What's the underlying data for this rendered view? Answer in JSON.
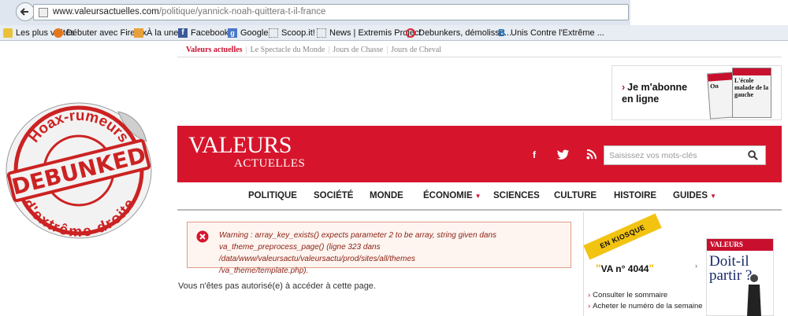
{
  "browser": {
    "url_host": "www.valeursactuelles.com",
    "url_path": "/politique/yannick-noah-quittera-t-il-france",
    "bookmarks": [
      {
        "label": "Les plus visités",
        "icon": "star-icon"
      },
      {
        "label": "Débuter avec Firefox",
        "icon": "firefox-icon"
      },
      {
        "label": "À la une",
        "icon": "feed-icon"
      },
      {
        "label": "Facebook",
        "icon": "facebook-icon"
      },
      {
        "label": "Google",
        "icon": "google-icon"
      },
      {
        "label": "Scoop.it!",
        "icon": "page-icon"
      },
      {
        "label": "News | Extremis Project",
        "icon": "page-icon"
      },
      {
        "label": "Debunkers, démolisse...",
        "icon": "target-icon"
      },
      {
        "label": "Unis Contre l'Extrême ...",
        "icon": "blogger-b-icon"
      }
    ]
  },
  "site_links": {
    "active": "Valeurs actuelles",
    "others": [
      "Le Spectacle du Monde",
      "Jours de Chasse",
      "Jours de Cheval"
    ]
  },
  "subscribe": {
    "label_line1": "Je m'abonne",
    "label_line2": "en ligne",
    "mag1_title": "On",
    "mag2_title": "L'école malade de la gauche"
  },
  "sticker": {
    "top_text": "Hoax-rumeurs",
    "center_text": "DEBUNKED",
    "bottom_text": "d'extrême-droite"
  },
  "header": {
    "logo_top": "VALEURS",
    "logo_bottom": "ACTUELLES",
    "search_placeholder": "Saisissez vos mots-clés"
  },
  "nav": {
    "items": [
      {
        "label": "POLITIQUE",
        "has_dropdown": false
      },
      {
        "label": "SOCIÉTÉ",
        "has_dropdown": false
      },
      {
        "label": "MONDE",
        "has_dropdown": false
      },
      {
        "label": "ÉCONOMIE",
        "has_dropdown": true
      },
      {
        "label": "SCIENCES",
        "has_dropdown": false
      },
      {
        "label": "CULTURE",
        "has_dropdown": false
      },
      {
        "label": "HISTOIRE",
        "has_dropdown": false
      },
      {
        "label": "GUIDES",
        "has_dropdown": true
      }
    ],
    "caret": "▼"
  },
  "warning": {
    "label": "Warning",
    "message_line1": " : array_key_exists() expects parameter 2 to be array, string given dans",
    "message_line2": "va_theme_preprocess_page() (ligne 323 dans /data/www/valeursactu/valeursactu/prod/sites/all/themes",
    "message_line3": "/va_theme/template.php)."
  },
  "access_message": "Vous n'êtes pas autorisé(e) à accéder à cette page.",
  "kiosk": {
    "badge": "EN KIOSQUE",
    "issue": "VA n° 4044",
    "links": [
      "Consulter le sommaire",
      "Acheter le numéro de la semaine"
    ],
    "cover_brand": "VALEURS",
    "cover_title_line1": "Doit-il",
    "cover_title_line2": "partir ?"
  },
  "colors": {
    "brand_red": "#d6152c",
    "kiosk_yellow": "#f2c311",
    "warning_bg": "#fef5f1",
    "warning_text": "#8a1f11"
  }
}
